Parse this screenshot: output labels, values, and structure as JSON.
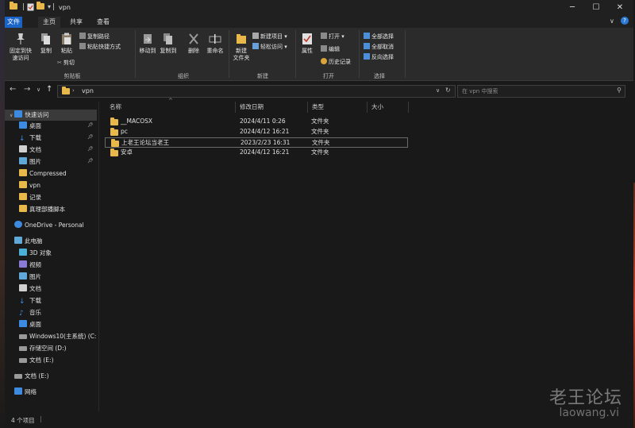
{
  "window": {
    "title": "vpn",
    "controls": {
      "minimize": "─",
      "maximize": "☐",
      "close": "✕"
    }
  },
  "ribbon_tabs": [
    "文件",
    "主页",
    "共享",
    "查看"
  ],
  "ribbon": {
    "clipboard": {
      "pin_label_1": "固定到快",
      "pin_label_2": "速访问",
      "copy": "复制",
      "paste": "粘贴",
      "copy_path": "复制路径",
      "paste_shortcut": "粘贴快捷方式",
      "cut": "剪切",
      "group": "剪贴板"
    },
    "organize": {
      "move_to": "移动到",
      "copy_to": "复制到",
      "delete": "删除",
      "rename": "重命名",
      "group": "组织"
    },
    "new": {
      "new_folder_1": "新建",
      "new_folder_2": "文件夹",
      "new_item": "新建项目 ▾",
      "easy_access": "轻松访问 ▾",
      "group": "新建"
    },
    "open": {
      "properties": "属性",
      "open": "打开 ▾",
      "edit": "编辑",
      "history": "历史记录",
      "group": "打开"
    },
    "select": {
      "select_all": "全部选择",
      "select_none": "全部取消",
      "invert": "反向选择",
      "group": "选择"
    }
  },
  "address": {
    "path": "vpn",
    "search_placeholder": "在 vpn 中搜索"
  },
  "columns": {
    "name": "名称",
    "date": "修改日期",
    "type": "类型",
    "size": "大小"
  },
  "files": [
    {
      "name": "__MACOSX",
      "date": "2024/4/11 0:26",
      "type": "文件夹"
    },
    {
      "name": "pc",
      "date": "2024/4/12 16:21",
      "type": "文件夹"
    },
    {
      "name": "上老王论坛当老王",
      "date": "2023/2/23 16:31",
      "type": "文件夹"
    },
    {
      "name": "安卓",
      "date": "2024/4/12 16:21",
      "type": "文件夹"
    }
  ],
  "nav": {
    "quick_access": "快速访问",
    "desktop": "桌面",
    "downloads": "下载",
    "documents": "文档",
    "pictures": "图片",
    "compressed": "Compressed",
    "vpn": "vpn",
    "records": "记录",
    "scripts": "真理部播脚本",
    "onedrive": "OneDrive - Personal",
    "this_pc": "此电脑",
    "objects3d": "3D 对象",
    "videos": "视频",
    "pictures2": "图片",
    "documents2": "文档",
    "downloads2": "下载",
    "music": "音乐",
    "desktop2": "桌面",
    "drive_c": "Windows10(主系统) (C:",
    "drive_d": "存储空间 (D:)",
    "drive_e": "文档 (E:)",
    "drive_e2": "文档 (E:)",
    "network": "网络"
  },
  "status": {
    "count": "4 个项目"
  },
  "watermark": {
    "line1": "老王论坛",
    "line2": "laowang.vi"
  },
  "colors": {
    "accent": "#1a64c8",
    "folder": "#e8b84a",
    "background": "#191919"
  }
}
